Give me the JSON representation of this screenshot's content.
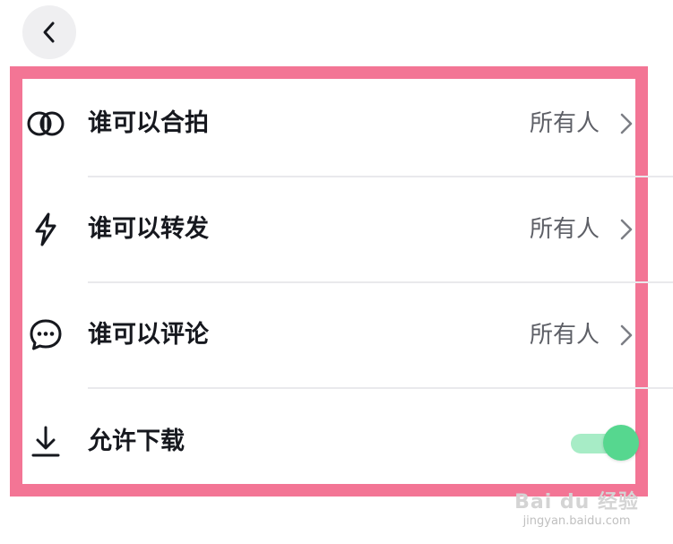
{
  "header": {
    "back_icon": "chevron-left-icon"
  },
  "settings": {
    "rows": [
      {
        "icon": "duet-icon",
        "label": "谁可以合拍",
        "value": "所有人"
      },
      {
        "icon": "lightning-icon",
        "label": "谁可以转发",
        "value": "所有人"
      },
      {
        "icon": "comment-icon",
        "label": "谁可以评论",
        "value": "所有人"
      },
      {
        "icon": "download-icon",
        "label": "允许下载",
        "toggle_on": true
      }
    ]
  },
  "colors": {
    "highlight_border": "#f37595",
    "toggle_track": "#a7ecc6",
    "toggle_knob": "#56d78f"
  },
  "watermark": {
    "brand": "Bai du 经验",
    "url": "jingyan.baidu.com"
  }
}
